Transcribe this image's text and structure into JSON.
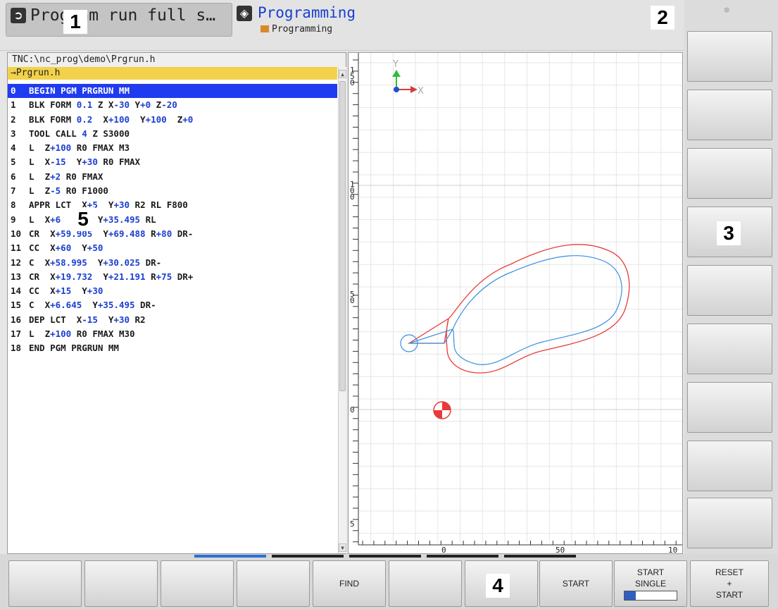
{
  "header": {
    "mode_label": "Program run full s…",
    "prog_title": "Programming",
    "prog_subtitle": "Programming",
    "callouts": [
      "1",
      "2",
      "3",
      "4",
      "5"
    ]
  },
  "program": {
    "path": "TNC:\\nc_prog\\demo\\Prgrun.h",
    "file": "→Prgrun.h",
    "lines": [
      {
        "n": "0",
        "segs": [
          [
            "BEGIN PGM PRGRUN MM",
            ""
          ]
        ]
      },
      {
        "n": "1",
        "segs": [
          [
            "BLK FORM ",
            ""
          ],
          [
            "0.1",
            "b"
          ],
          [
            " Z X",
            ""
          ],
          [
            "-30",
            "b"
          ],
          [
            " Y",
            ""
          ],
          [
            "+0",
            "b"
          ],
          [
            " Z",
            ""
          ],
          [
            "-20",
            "b"
          ]
        ]
      },
      {
        "n": "2",
        "segs": [
          [
            "BLK FORM ",
            ""
          ],
          [
            "0.2",
            "b"
          ],
          [
            "  X",
            ""
          ],
          [
            "+100",
            "b"
          ],
          [
            "  Y",
            ""
          ],
          [
            "+100",
            "b"
          ],
          [
            "  Z",
            ""
          ],
          [
            "+0",
            "b"
          ]
        ]
      },
      {
        "n": "3",
        "segs": [
          [
            "TOOL CALL ",
            ""
          ],
          [
            "4",
            "b"
          ],
          [
            " Z S3000",
            ""
          ]
        ]
      },
      {
        "n": "4",
        "segs": [
          [
            "L  Z",
            ""
          ],
          [
            "+100",
            "b"
          ],
          [
            " R0 FMAX M3",
            ""
          ]
        ]
      },
      {
        "n": "5",
        "segs": [
          [
            "L  X",
            ""
          ],
          [
            "-15",
            "b"
          ],
          [
            "  Y",
            ""
          ],
          [
            "+30",
            "b"
          ],
          [
            " R0 FMAX",
            ""
          ]
        ]
      },
      {
        "n": "6",
        "segs": [
          [
            "L  Z",
            ""
          ],
          [
            "+2",
            "b"
          ],
          [
            " R0 FMAX",
            ""
          ]
        ]
      },
      {
        "n": "7",
        "segs": [
          [
            "L  Z",
            ""
          ],
          [
            "-5",
            "b"
          ],
          [
            " R0 F1000",
            ""
          ]
        ]
      },
      {
        "n": "8",
        "segs": [
          [
            "APPR LCT  X",
            ""
          ],
          [
            "+5",
            "b"
          ],
          [
            "  Y",
            ""
          ],
          [
            "+30",
            "b"
          ],
          [
            " R2 RL F800",
            ""
          ]
        ]
      },
      {
        "n": "9",
        "segs": [
          [
            "L  X",
            ""
          ],
          [
            "+6",
            "b"
          ],
          [
            "       Y",
            ""
          ],
          [
            "+35.495",
            "b"
          ],
          [
            " RL",
            ""
          ]
        ]
      },
      {
        "n": "10",
        "segs": [
          [
            "CR  X",
            ""
          ],
          [
            "+59.905",
            "b"
          ],
          [
            "  Y",
            ""
          ],
          [
            "+69.488",
            "b"
          ],
          [
            " R",
            ""
          ],
          [
            "+80",
            "b"
          ],
          [
            " DR-",
            ""
          ]
        ]
      },
      {
        "n": "11",
        "segs": [
          [
            "CC  X",
            ""
          ],
          [
            "+60",
            "b"
          ],
          [
            "  Y",
            ""
          ],
          [
            "+50",
            "b"
          ]
        ]
      },
      {
        "n": "12",
        "segs": [
          [
            "C  X",
            ""
          ],
          [
            "+58.995",
            "b"
          ],
          [
            "  Y",
            ""
          ],
          [
            "+30.025",
            "b"
          ],
          [
            " DR-",
            ""
          ]
        ]
      },
      {
        "n": "13",
        "segs": [
          [
            "CR  X",
            ""
          ],
          [
            "+19.732",
            "b"
          ],
          [
            "  Y",
            ""
          ],
          [
            "+21.191",
            "b"
          ],
          [
            " R",
            ""
          ],
          [
            "+75",
            "b"
          ],
          [
            " DR+",
            ""
          ]
        ]
      },
      {
        "n": "14",
        "segs": [
          [
            "CC  X",
            ""
          ],
          [
            "+15",
            "b"
          ],
          [
            "  Y",
            ""
          ],
          [
            "+30",
            "b"
          ]
        ]
      },
      {
        "n": "15",
        "segs": [
          [
            "C  X",
            ""
          ],
          [
            "+6.645",
            "b"
          ],
          [
            "  Y",
            ""
          ],
          [
            "+35.495",
            "b"
          ],
          [
            " DR-",
            ""
          ]
        ]
      },
      {
        "n": "16",
        "segs": [
          [
            "DEP LCT  X",
            ""
          ],
          [
            "-15",
            "b"
          ],
          [
            "  Y",
            ""
          ],
          [
            "+30",
            "b"
          ],
          [
            " R2",
            ""
          ]
        ]
      },
      {
        "n": "17",
        "segs": [
          [
            "L  Z",
            ""
          ],
          [
            "+100",
            "b"
          ],
          [
            " R0 FMAX M30",
            ""
          ]
        ]
      },
      {
        "n": "18",
        "segs": [
          [
            "END PGM PRGRUN MM",
            ""
          ]
        ]
      }
    ]
  },
  "graphics": {
    "axis_x": "X",
    "axis_y": "Y",
    "left_ticks": [
      "1\n5\n0",
      "1\n0\n0",
      "5\n0",
      "0",
      "5"
    ],
    "bottom_ticks": [
      "0",
      "50",
      "10"
    ],
    "colors": {
      "contour": "#3a8fe0",
      "tool_path": "#e83a3a",
      "grid": "#e3e3e3"
    }
  },
  "softkeys": {
    "bottom": [
      "",
      "",
      "",
      "",
      "FIND",
      "",
      "",
      "START",
      "START\nSINGLE",
      "RESET\n+\nSTART"
    ]
  }
}
